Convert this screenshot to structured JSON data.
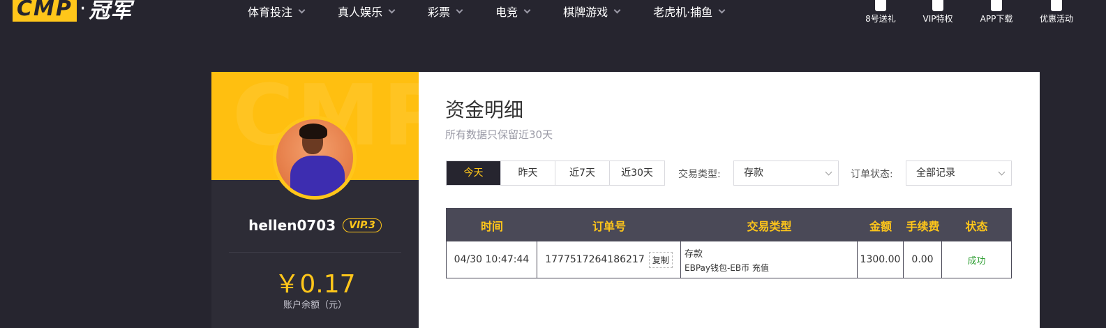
{
  "header": {
    "logo_badge": "CMP",
    "logo_dot": "·",
    "logo_cn": "冠军",
    "nav": [
      {
        "label": "体育投注"
      },
      {
        "label": "真人娱乐"
      },
      {
        "label": "彩票"
      },
      {
        "label": "电竞"
      },
      {
        "label": "棋牌游戏"
      },
      {
        "label": "老虎机·捕鱼"
      }
    ],
    "quick_links": [
      {
        "label": "8号送礼",
        "icon": "gift-icon"
      },
      {
        "label": "VIP特权",
        "icon": "vip-crown-icon"
      },
      {
        "label": "APP下载",
        "icon": "mobile-icon"
      },
      {
        "label": "优惠活动",
        "icon": "promotions-icon"
      }
    ]
  },
  "profile": {
    "banner_text": "CMP",
    "username": "hellen0703",
    "vip_level": "VIP.3",
    "balance": "￥0.17",
    "balance_label": "账户余额（元）"
  },
  "main": {
    "title": "资金明细",
    "subtitle": "所有数据只保留近30天",
    "date_tabs": [
      {
        "label": "今天",
        "active": true
      },
      {
        "label": "昨天",
        "active": false
      },
      {
        "label": "近7天",
        "active": false
      },
      {
        "label": "近30天",
        "active": false
      }
    ],
    "filters": {
      "type_label": "交易类型:",
      "type_value": "存款",
      "status_label": "订单状态:",
      "status_value": "全部记录"
    },
    "table": {
      "headers": [
        "时间",
        "订单号",
        "交易类型",
        "金额",
        "手续费",
        "状态"
      ],
      "rows": [
        {
          "time": "04/30 10:47:44",
          "order_no": "1777517264186217",
          "copy_label": "复制",
          "type_main": "存款",
          "type_sub": "EBPay钱包-EB币 充值",
          "amount": "1300.00",
          "fee": "0.00",
          "status": "成功"
        }
      ]
    },
    "colors": {
      "accent": "#ffc61a",
      "dark": "#26252f",
      "success": "#2f9e33"
    }
  }
}
